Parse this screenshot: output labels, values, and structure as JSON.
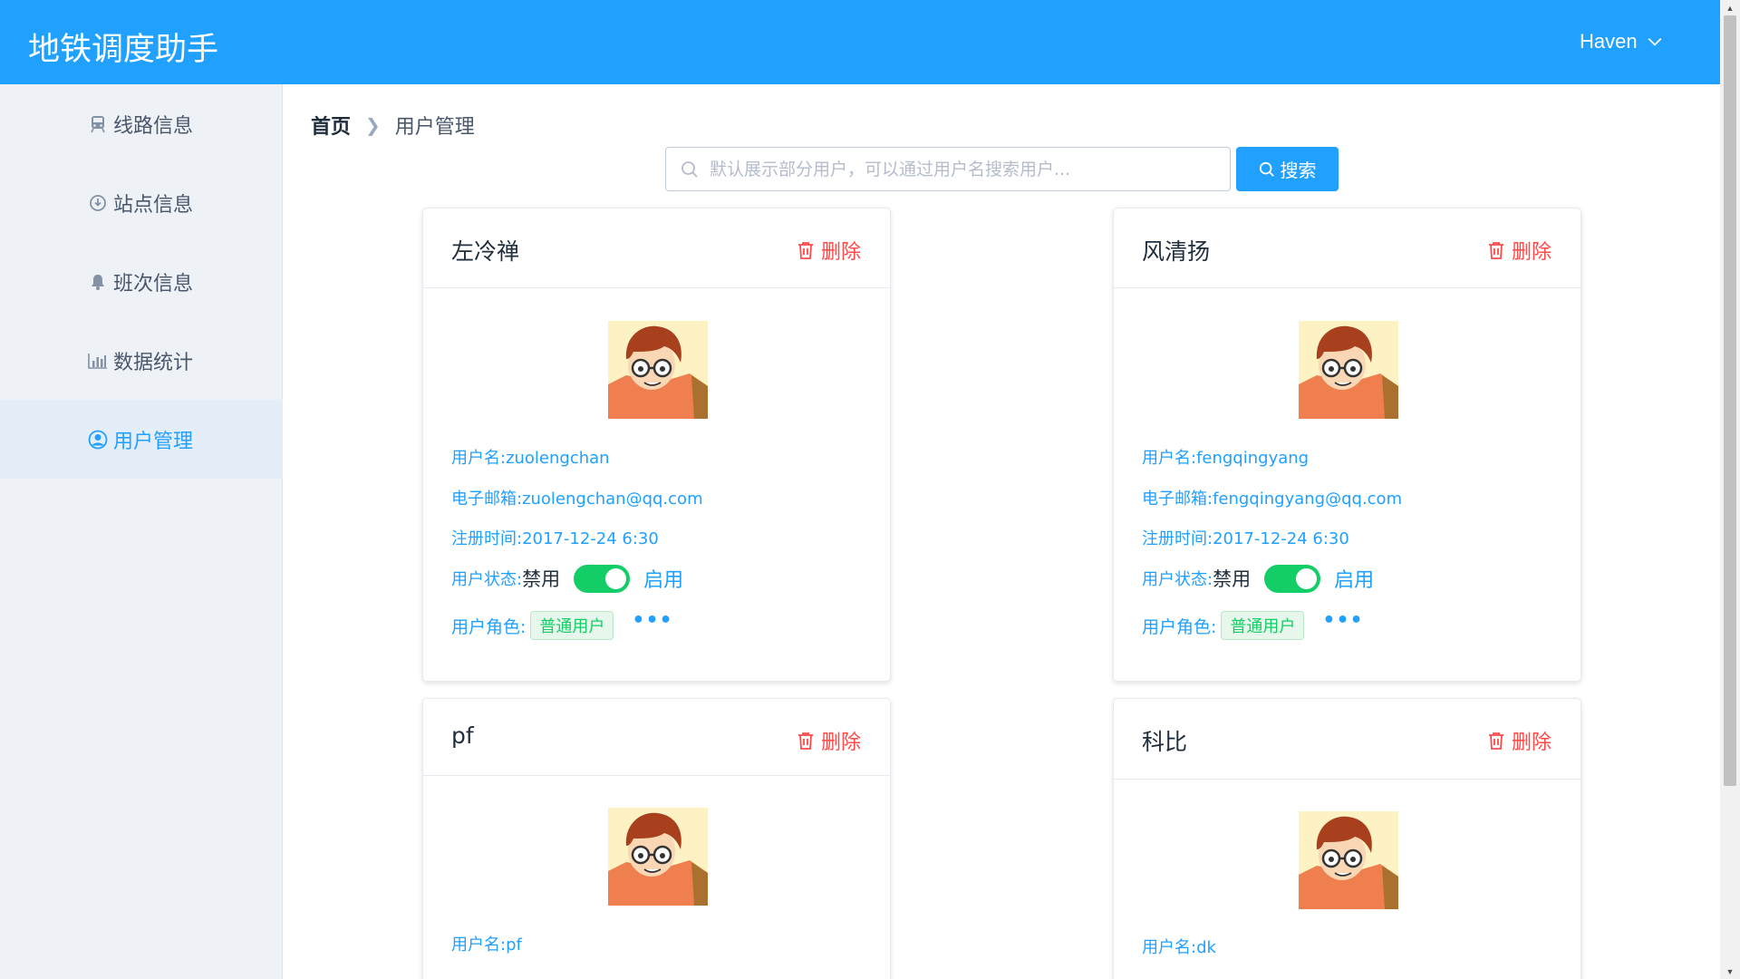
{
  "header": {
    "title": "地铁调度助手",
    "user": "Haven"
  },
  "sidebar": {
    "items": [
      {
        "label": "线路信息",
        "icon": "train-icon"
      },
      {
        "label": "站点信息",
        "icon": "download-circle-icon"
      },
      {
        "label": "班次信息",
        "icon": "bell-icon"
      },
      {
        "label": "数据统计",
        "icon": "bar-chart-icon"
      },
      {
        "label": "用户管理",
        "icon": "user-circle-icon",
        "active": true
      }
    ]
  },
  "breadcrumb": {
    "home": "首页",
    "current": "用户管理"
  },
  "search": {
    "placeholder": "默认展示部分用户，可以通过用户名搜索用户...",
    "button": "搜索"
  },
  "cards": [
    {
      "name": "左冷禅",
      "delete": "删除",
      "username": "用户名:zuolengchan",
      "email": "电子邮箱:zuolengchan@qq.com",
      "registered": "注册时间:2017-12-24 6:30",
      "status_label": "用户状态:",
      "status_off": "禁用",
      "status_on": "启用",
      "role_label": "用户角色:",
      "role_tag": "普通用户"
    },
    {
      "name": "风清扬",
      "delete": "删除",
      "username": "用户名:fengqingyang",
      "email": "电子邮箱:fengqingyang@qq.com",
      "registered": "注册时间:2017-12-24 6:30",
      "status_label": "用户状态:",
      "status_off": "禁用",
      "status_on": "启用",
      "role_label": "用户角色:",
      "role_tag": "普通用户"
    },
    {
      "name": "pf",
      "delete": "删除",
      "username": "用户名:pf"
    },
    {
      "name": "科比",
      "delete": "删除",
      "username": "用户名:dk"
    }
  ],
  "colors": {
    "primary": "#20a0ff",
    "danger": "#ff4949",
    "success": "#13ce66",
    "sidebar_bg": "#eef1f6"
  }
}
